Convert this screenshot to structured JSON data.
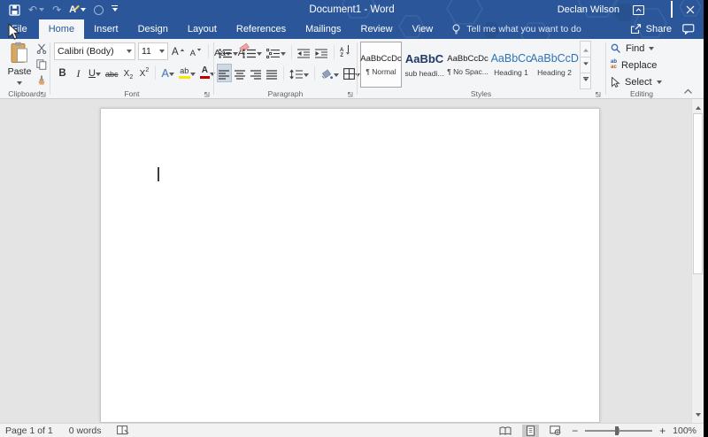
{
  "title_bar": {
    "title": "Document1 - Word",
    "user": "Declan Wilson"
  },
  "tabs": {
    "file": "File",
    "items": [
      "Home",
      "Insert",
      "Design",
      "Layout",
      "References",
      "Mailings",
      "Review",
      "View"
    ],
    "active": "Home",
    "tell_me": "Tell me what you want to do",
    "share": "Share"
  },
  "ribbon": {
    "clipboard": {
      "label": "Clipboard",
      "paste": "Paste"
    },
    "font": {
      "label": "Font",
      "family": "Calibri (Body)",
      "size": "11",
      "grow": "A",
      "shrink": "A",
      "change_case": "Aa",
      "clear": "A",
      "bold": "B",
      "italic": "I",
      "underline": "U",
      "strikethrough": "abc",
      "subscript_base": "X",
      "subscript_n": "2",
      "superscript_base": "X",
      "superscript_n": "2",
      "effects": "A",
      "highlight": "ab",
      "font_color": "A"
    },
    "paragraph": {
      "label": "Paragraph",
      "pilcrow": "¶",
      "sort_letter": "A",
      "sort_letter2": "Z"
    },
    "styles": {
      "label": "Styles",
      "items": [
        {
          "sample": "AaBbCcDc",
          "name": "¶ Normal"
        },
        {
          "sample": "AaBbC",
          "name": "sub headi..."
        },
        {
          "sample": "AaBbCcDc",
          "name": "¶ No Spac..."
        },
        {
          "sample": "AaBbCc",
          "name": "Heading 1"
        },
        {
          "sample": "AaBbCcD",
          "name": "Heading 2"
        }
      ]
    },
    "editing": {
      "label": "Editing",
      "find": "Find",
      "replace": "Replace",
      "select": "Select",
      "replace_icon_top": "ab",
      "replace_icon_bottom": "ac"
    }
  },
  "status_bar": {
    "page_info": "Page 1 of 1",
    "word_count": "0 words",
    "zoom_out": "−",
    "zoom_in": "+",
    "zoom_level": "100%"
  },
  "icons": {
    "undo_glyph": "↶",
    "redo_glyph": "↷",
    "qat_style_letter": "A"
  },
  "colors": {
    "titlebar_blue": "#2b579a",
    "active_tab_text": "#2b579a",
    "heading_style_blue": "#2e74b5",
    "subheading_navy": "#1f3864",
    "highlight_yellow": "#ffe400",
    "font_color_red": "#c00000",
    "paste_clipboard_tan": "#d9a860"
  }
}
